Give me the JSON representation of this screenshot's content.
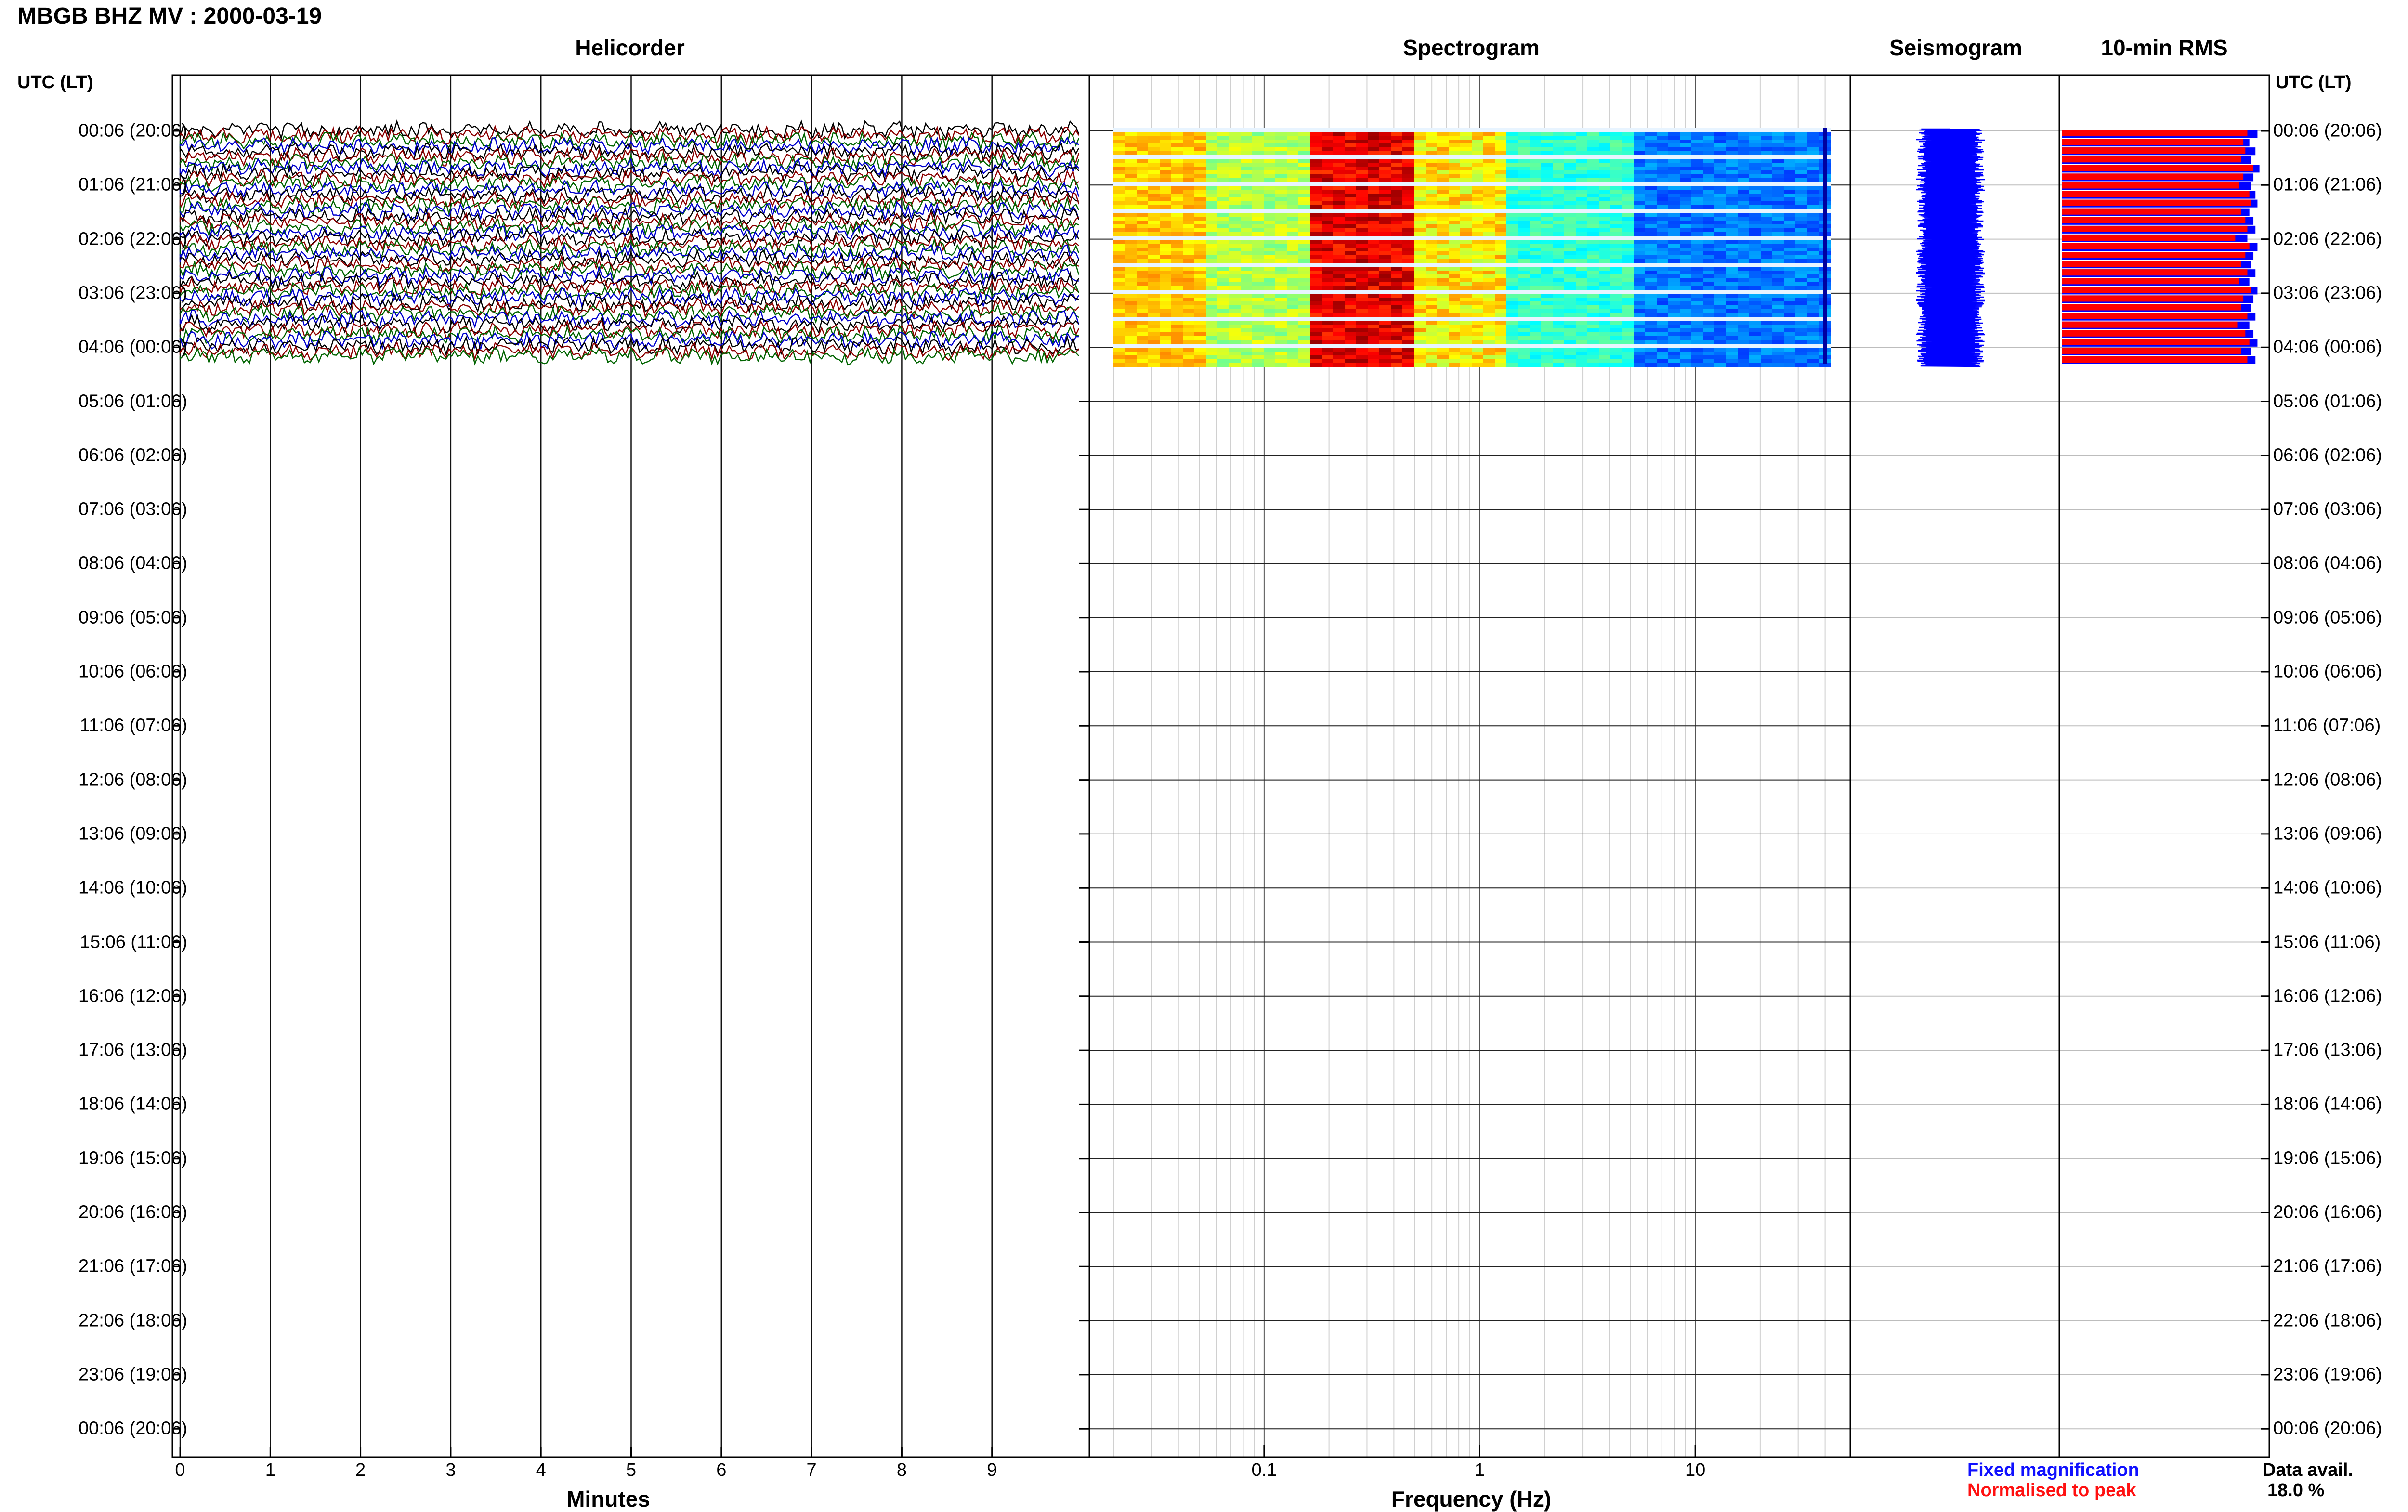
{
  "title": "MBGB BHZ MV : 2000-03-19",
  "panels": {
    "helicorder": "Helicorder",
    "spectrogram": "Spectrogram",
    "seismogram": "Seismogram",
    "rms": "10-min RMS"
  },
  "utc_header_left": "UTC (LT)",
  "utc_header_right": "UTC (LT)",
  "time_labels": [
    "00:06 (20:06)",
    "01:06 (21:06)",
    "02:06 (22:06)",
    "03:06 (23:06)",
    "04:06 (00:06)",
    "05:06 (01:06)",
    "06:06 (02:06)",
    "07:06 (03:06)",
    "08:06 (04:06)",
    "09:06 (05:06)",
    "10:06 (06:06)",
    "11:06 (07:06)",
    "12:06 (08:06)",
    "13:06 (09:06)",
    "14:06 (10:06)",
    "15:06 (11:06)",
    "16:06 (12:06)",
    "17:06 (13:06)",
    "18:06 (14:06)",
    "19:06 (15:06)",
    "20:06 (16:06)",
    "21:06 (17:06)",
    "22:06 (18:06)",
    "23:06 (19:06)",
    "00:06 (20:06)"
  ],
  "helicorder_axis": {
    "xlabel": "Minutes",
    "ticks": [
      "0",
      "1",
      "2",
      "3",
      "4",
      "5",
      "6",
      "7",
      "8",
      "9"
    ],
    "trace_colors": [
      "#000000",
      "#8b0000",
      "#006400",
      "#0000cd"
    ]
  },
  "spectrogram_axis": {
    "xlabel": "Frequency (Hz)",
    "ticks": [
      "0.1",
      "1",
      "10"
    ],
    "xlim": [
      0.02,
      50
    ],
    "scale": "log"
  },
  "legend": {
    "fixed": "Fixed magnification",
    "fixed_color": "#1010ff",
    "normalised": "Normalised to peak",
    "normalised_color": "#ff1010"
  },
  "data_availability": {
    "label": "Data avail.",
    "value": "18.0 %"
  },
  "chart_data": {
    "type": "heatmap",
    "title": "MBGB BHZ MV : 2000-03-19",
    "description_rows": 24,
    "rows_with_data": 4.5,
    "rms_fixed_fraction": [
      0.97,
      0.93,
      0.96,
      0.94,
      0.98,
      0.95,
      0.94,
      0.96,
      0.97,
      0.93,
      0.95,
      0.96,
      0.92,
      0.97,
      0.95,
      0.94,
      0.96,
      0.93,
      0.97,
      0.95,
      0.94,
      0.96,
      0.93,
      0.95,
      0.97,
      0.94,
      0.96
    ],
    "rms_normalised_fraction": [
      0.92,
      0.9,
      0.91,
      0.89,
      0.95,
      0.9,
      0.88,
      0.93,
      0.94,
      0.89,
      0.91,
      0.92,
      0.86,
      0.93,
      0.91,
      0.89,
      0.92,
      0.88,
      0.94,
      0.9,
      0.89,
      0.92,
      0.87,
      0.91,
      0.93,
      0.89,
      0.92
    ]
  }
}
